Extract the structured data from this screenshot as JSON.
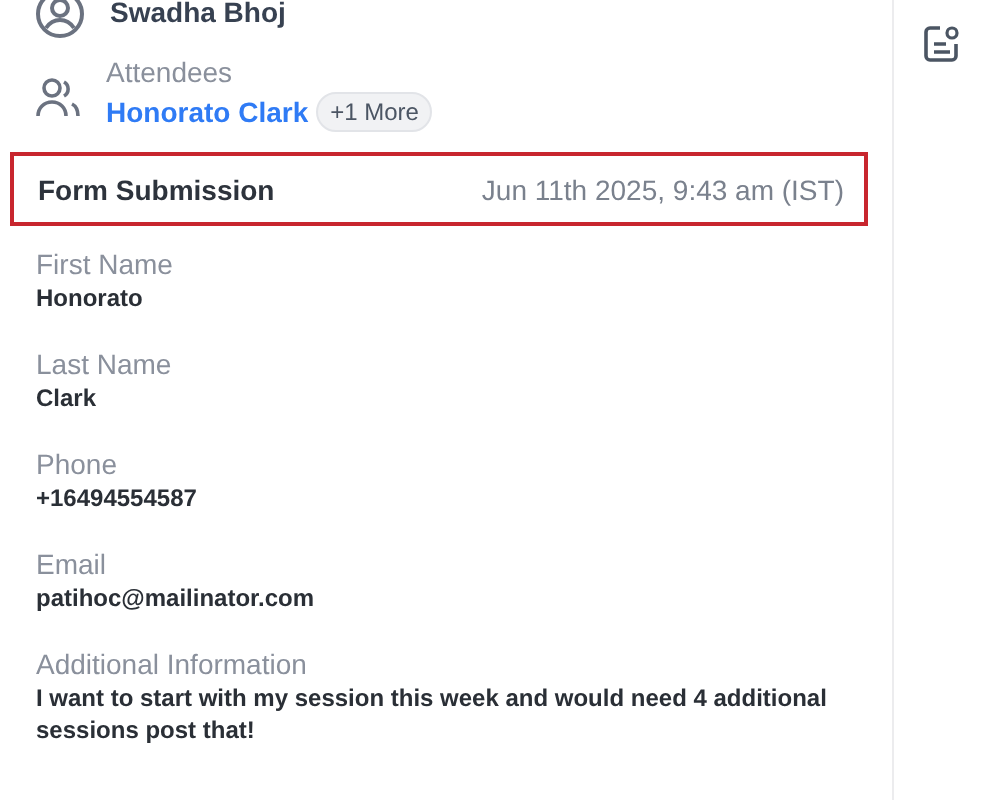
{
  "organizer": {
    "name": "Swadha Bhoj"
  },
  "attendees": {
    "label": "Attendees",
    "name": "Honorato Clark",
    "more": "+1 More"
  },
  "form_submission": {
    "title": "Form Submission",
    "timestamp": "Jun 11th 2025, 9:43 am (IST)",
    "highlighted": true
  },
  "fields": [
    {
      "label": "First Name",
      "value": "Honorato"
    },
    {
      "label": "Last Name",
      "value": "Clark"
    },
    {
      "label": "Phone",
      "value": "+16494554587"
    },
    {
      "label": "Email",
      "value": "patihoc@mailinator.com"
    },
    {
      "label": "Additional Information",
      "value": "I want to start with my session this week and would need 4 additional sessions post that!"
    }
  ]
}
